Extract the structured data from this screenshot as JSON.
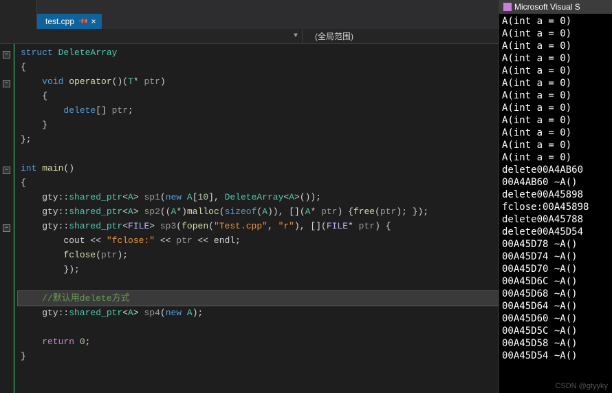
{
  "tab": {
    "filename": "test.cpp"
  },
  "nav": {
    "left_text": "",
    "scope": "(全局范围)"
  },
  "code": {
    "l1": {
      "a": "struct",
      "b": " DeleteArray"
    },
    "l2": "{",
    "l3": {
      "a": "    void",
      "b": " operator",
      "c": "()(",
      "d": "T",
      "e": "*",
      "f": " ptr",
      "g": ")"
    },
    "l4": "    {",
    "l5": {
      "a": "        delete",
      "b": "[]",
      "c": " ptr",
      "d": ";"
    },
    "l6": "    }",
    "l7": "};",
    "l8": "",
    "l9": {
      "a": "int",
      "b": " main",
      "c": "()"
    },
    "l10": "{",
    "l11": {
      "a": "    gty",
      "b": "::",
      "c": "shared_ptr",
      "d": "<",
      "e": "A",
      "f": ">",
      "g": " sp1",
      "h": "(",
      "i": "new",
      "j": " A",
      "k": "[",
      "l": "10",
      "m": "]",
      "n": ", ",
      "o": "DeleteArray",
      "p": "<",
      "q": "A",
      "r": ">",
      "s": "())",
      "t": ";"
    },
    "l12": {
      "a": "    gty",
      "b": "::",
      "c": "shared_ptr",
      "d": "<",
      "e": "A",
      "f": ">",
      "g": " sp2",
      "h": "((",
      "i": "A",
      "j": "*",
      "k": ")",
      "l": "malloc",
      "m": "(",
      "n": "sizeof",
      "o": "(",
      "p": "A",
      "q": "))",
      "r": ", ",
      "s": "[]",
      "t": "(",
      "u": "A",
      "v": "*",
      "w": " ptr",
      "x": ") {",
      "y": "free",
      "z": "(",
      "aa": "ptr",
      "ab": ")",
      "ac": "; })",
      "ad": ";"
    },
    "l13": {
      "a": "    gty",
      "b": "::",
      "c": "shared_ptr",
      "d": "<",
      "e": "FILE",
      "f": ">",
      "g": " sp3",
      "h": "(",
      "i": "fopen",
      "j": "(",
      "k": "\"Test.cpp\"",
      "l": ", ",
      "m": "\"r\"",
      "n": ")",
      "o": ", ",
      "p": "[]",
      "q": "(",
      "r": "FILE",
      "s": "*",
      "t": " ptr",
      "u": ") {"
    },
    "l14": {
      "a": "        cout",
      "b": " << ",
      "c": "\"fclose:\"",
      "d": " << ",
      "e": "ptr",
      "f": " << ",
      "g": "endl",
      "h": ";"
    },
    "l15": {
      "a": "        fclose",
      "b": "(",
      "c": "ptr",
      "d": ")",
      "e": ";"
    },
    "l16": "        });",
    "l17": "",
    "l18": "    //默认用delete方式",
    "l19": {
      "a": "    gty",
      "b": "::",
      "c": "shared_ptr",
      "d": "<",
      "e": "A",
      "f": ">",
      "g": " sp4",
      "h": "(",
      "i": "new",
      "j": " A",
      "k": ")",
      "l": ";"
    },
    "l20": "",
    "l21": {
      "a": "    return",
      "b": " 0",
      "c": ";"
    },
    "l22": "}"
  },
  "console": {
    "title": "Microsoft Visual S",
    "lines": [
      "A(int a = 0)",
      "A(int a = 0)",
      "A(int a = 0)",
      "A(int a = 0)",
      "A(int a = 0)",
      "A(int a = 0)",
      "A(int a = 0)",
      "A(int a = 0)",
      "A(int a = 0)",
      "A(int a = 0)",
      "A(int a = 0)",
      "A(int a = 0)",
      "delete00A4AB60",
      "00A4AB60 ~A()",
      "delete00A45898",
      "fclose:00A45898",
      "delete00A45788",
      "delete00A45D54",
      "00A45D78 ~A()",
      "00A45D74 ~A()",
      "00A45D70 ~A()",
      "00A45D6C ~A()",
      "00A45D68 ~A()",
      "00A45D64 ~A()",
      "00A45D60 ~A()",
      "00A45D5C ~A()",
      "00A45D58 ~A()",
      "00A45D54 ~A()"
    ]
  },
  "watermark": "CSDN @gtyyky"
}
